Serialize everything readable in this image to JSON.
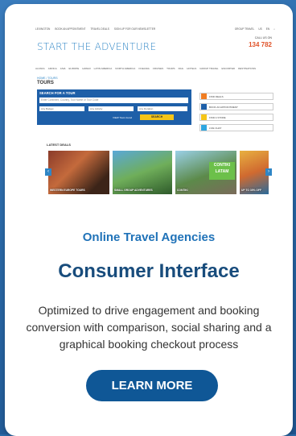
{
  "screenshot": {
    "topbar": {
      "left": [
        "LEXINGTON",
        "BOOK AN APPOINTMENT",
        "TRAVEL DEALS",
        "SIGN UP FOR OUR NEWSLETTER"
      ],
      "right": [
        "GROUP TRAVEL",
        "US",
        "EN"
      ]
    },
    "logo": "START THE ADVENTURE",
    "call_us": "CALL US ON",
    "phone": "134 782",
    "nav": [
      "ALASKA",
      "AFRICA",
      "ASIA",
      "EUROPE",
      "HAWAII",
      "LATIN AMERICA",
      "NORTH AMERICA",
      "OCEANIA",
      "CRUISES",
      "TOURS",
      "RAIL",
      "HOTELS",
      "GROUP TRAVEL",
      "ESCORTED",
      "DESTINATIONS"
    ],
    "breadcrumb": "HOME / TOURS",
    "page_title": "TOURS",
    "search": {
      "title": "SEARCH FOR A TOUR",
      "input_placeholder": "Enter Continent, Country, Tour Name or Tour Code",
      "selects": [
        "Any Budget",
        "Any Activity",
        "Any Duration"
      ],
      "link": "VIEW Tours found",
      "button": "SEARCH"
    },
    "side_items": [
      {
        "label": "FIND DEALS",
        "color": "#f07d22"
      },
      {
        "label": "BOOK AN APPOINTMENT",
        "color": "#1e5fa8"
      },
      {
        "label": "FIND A STORE",
        "color": "#f5c518"
      },
      {
        "label": "LIVE CHAT",
        "color": "#2fa6e0"
      }
    ],
    "latest_deals": "LATEST DEALS",
    "deals": [
      "WESTERN EUROPE TOURS",
      "SMALL GROUP ADVENTURES",
      "CONTIKI",
      "UP TO 30% OFF"
    ],
    "deal_overlay": "CONTIKI LATAM"
  },
  "category": "Online Travel Agencies",
  "headline": "Consumer Interface",
  "description": "Optimized to drive engagement and booking conversion with comparison, social sharing and a graphical booking checkout process",
  "cta": "LEARN MORE",
  "colors": {
    "accent": "#1f72b8",
    "heading": "#184c7c",
    "button": "#0f5796",
    "background": "#2a6aa8"
  }
}
